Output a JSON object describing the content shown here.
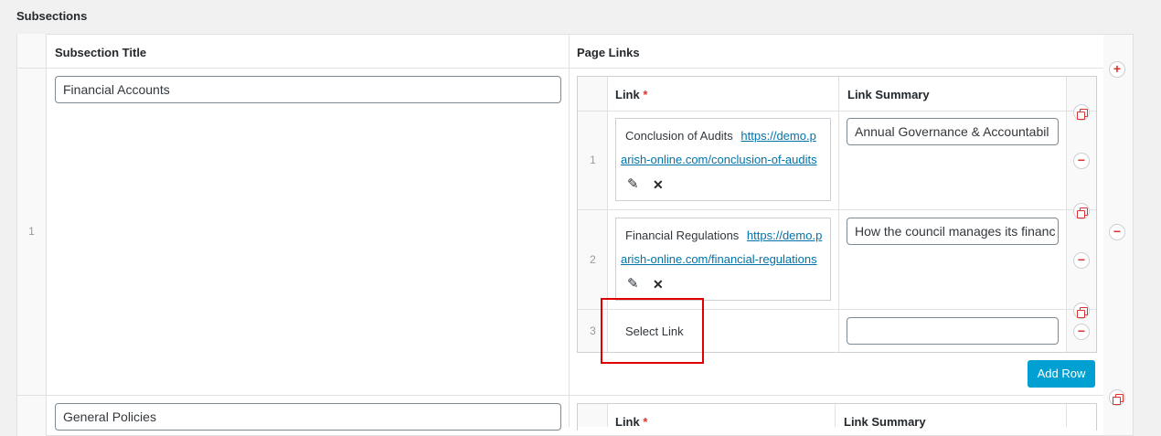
{
  "section": {
    "heading": "Subsections"
  },
  "outer": {
    "col_title": "Subsection Title",
    "col_links": "Page Links",
    "rows": [
      {
        "num": "1",
        "title_value": "Financial Accounts"
      },
      {
        "num": "",
        "title_value": "General Policies"
      }
    ]
  },
  "inner": {
    "col_link": "Link",
    "required_mark": "*",
    "col_summary": "Link Summary",
    "rows": [
      {
        "num": "1",
        "link_title": "Conclusion of Audits",
        "url_line1": "https://demo.p",
        "url_line2": "arish-online.com/conclusion-of-audits",
        "summary": "Annual Governance & Accountabil"
      },
      {
        "num": "2",
        "link_title": "Financial Regulations",
        "url_line1": "https://demo.p",
        "url_line2": "arish-online.com/financial-regulations",
        "summary": "How the council manages its financ"
      },
      {
        "num": "3",
        "select_link": "Select Link",
        "summary": ""
      }
    ],
    "add_row": "Add Row"
  },
  "inner2": {
    "col_link": "Link",
    "col_summary": "Link Summary"
  },
  "icons": {
    "edit": "✎",
    "remove_link": "✕",
    "add": "+",
    "remove_row": "−"
  },
  "colors": {
    "accent": "#00a0d2",
    "danger": "#dc3232",
    "link": "#0073aa",
    "highlight": "#e00000"
  }
}
